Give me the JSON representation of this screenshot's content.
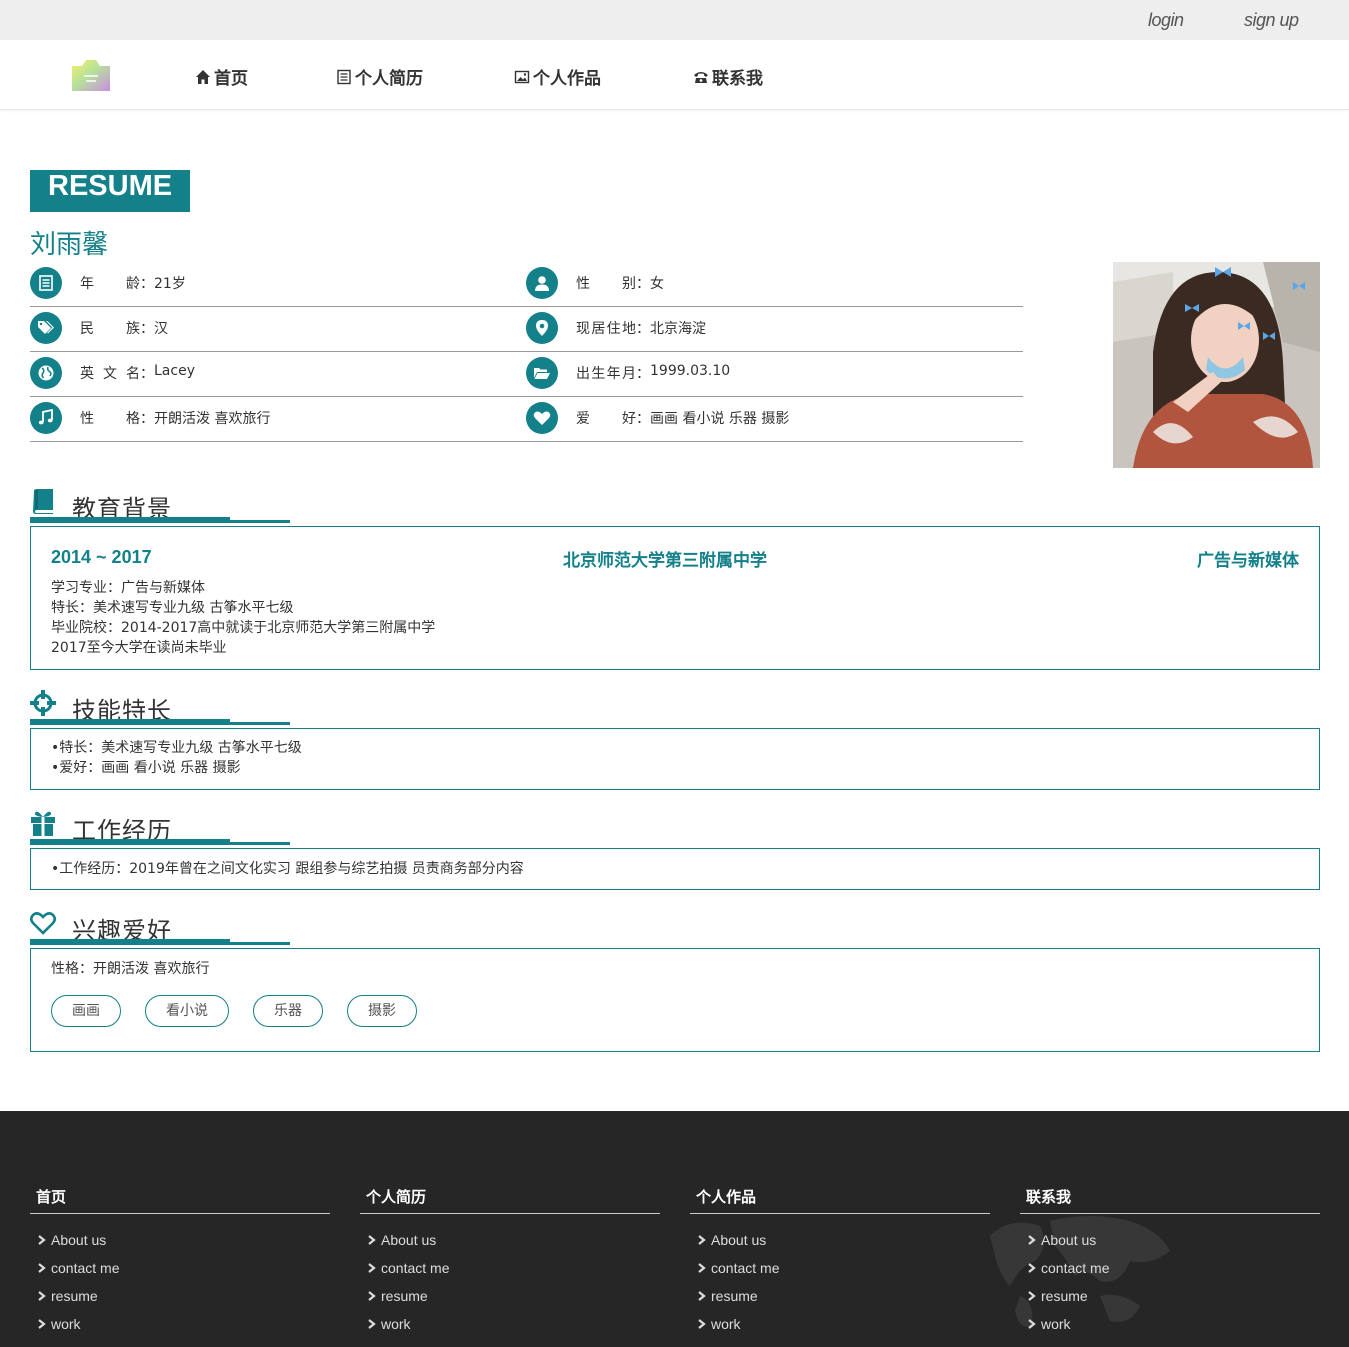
{
  "topbar": {
    "login": "login",
    "signup": "sign up"
  },
  "nav": {
    "items": [
      {
        "label": "首页",
        "icon": "home-icon"
      },
      {
        "label": "个人简历",
        "icon": "list-icon"
      },
      {
        "label": "个人作品",
        "icon": "picture-icon"
      },
      {
        "label": "联系我",
        "icon": "phone-icon"
      }
    ]
  },
  "resume": {
    "tag": "RESUME",
    "name": "刘雨馨"
  },
  "info": {
    "rows": [
      {
        "left": {
          "label": "年龄",
          "value": "21岁",
          "icon": "list-icon"
        },
        "right": {
          "label": "性别",
          "value": "女",
          "icon": "user-icon"
        }
      },
      {
        "left": {
          "label": "民族",
          "value": "汉",
          "icon": "tags-icon"
        },
        "right": {
          "label": "现居住地",
          "value": "北京海淀",
          "icon": "map-marker-icon"
        }
      },
      {
        "left": {
          "label": "英文名",
          "value": "Lacey",
          "icon": "globe-icon"
        },
        "right": {
          "label": "出生年月",
          "value": "1999.03.10",
          "icon": "folder-open-icon"
        }
      },
      {
        "left": {
          "label": "性格",
          "value": "开朗活泼 喜欢旅行",
          "icon": "music-icon"
        },
        "right": {
          "label": "爱好",
          "value": "画画 看小说 乐器 摄影",
          "icon": "heart-icon"
        }
      }
    ],
    "separator": "："
  },
  "education": {
    "title": "教育背景",
    "period": "2014 ~ 2017",
    "school": "北京师范大学第三附属中学",
    "major": "广告与新媒体",
    "lines": [
      "学习专业：广告与新媒体",
      "特长：美术速写专业九级 古筝水平七级",
      "毕业院校：2014-2017高中就读于北京师范大学第三附属中学",
      "2017至今大学在读尚未毕业"
    ]
  },
  "skills": {
    "title": "技能特长",
    "lines": [
      "•特长：美术速写专业九级 古筝水平七级",
      "•爱好：画画 看小说 乐器 摄影"
    ]
  },
  "work": {
    "title": "工作经历",
    "lines": [
      "•工作经历：2019年曾在之间文化实习 跟组参与综艺拍摄 员责商务部分内容"
    ]
  },
  "hobbies": {
    "title": "兴趣爱好",
    "line": "性格：开朗活泼 喜欢旅行",
    "tags": [
      "画画",
      "看小说",
      "乐器",
      "摄影"
    ]
  },
  "footer": {
    "columns": [
      {
        "title": "首页",
        "links": [
          "About us",
          "contact me",
          "resume",
          "work"
        ]
      },
      {
        "title": "个人简历",
        "links": [
          "About us",
          "contact me",
          "resume",
          "work"
        ]
      },
      {
        "title": "个人作品",
        "links": [
          "About us",
          "contact me",
          "resume",
          "work"
        ]
      },
      {
        "title": "联系我",
        "links": [
          "About us",
          "contact me",
          "resume",
          "work"
        ]
      }
    ]
  },
  "colors": {
    "accent": "#13808a",
    "footer_bg": "#262626",
    "topbar_bg": "#eeeeee"
  }
}
